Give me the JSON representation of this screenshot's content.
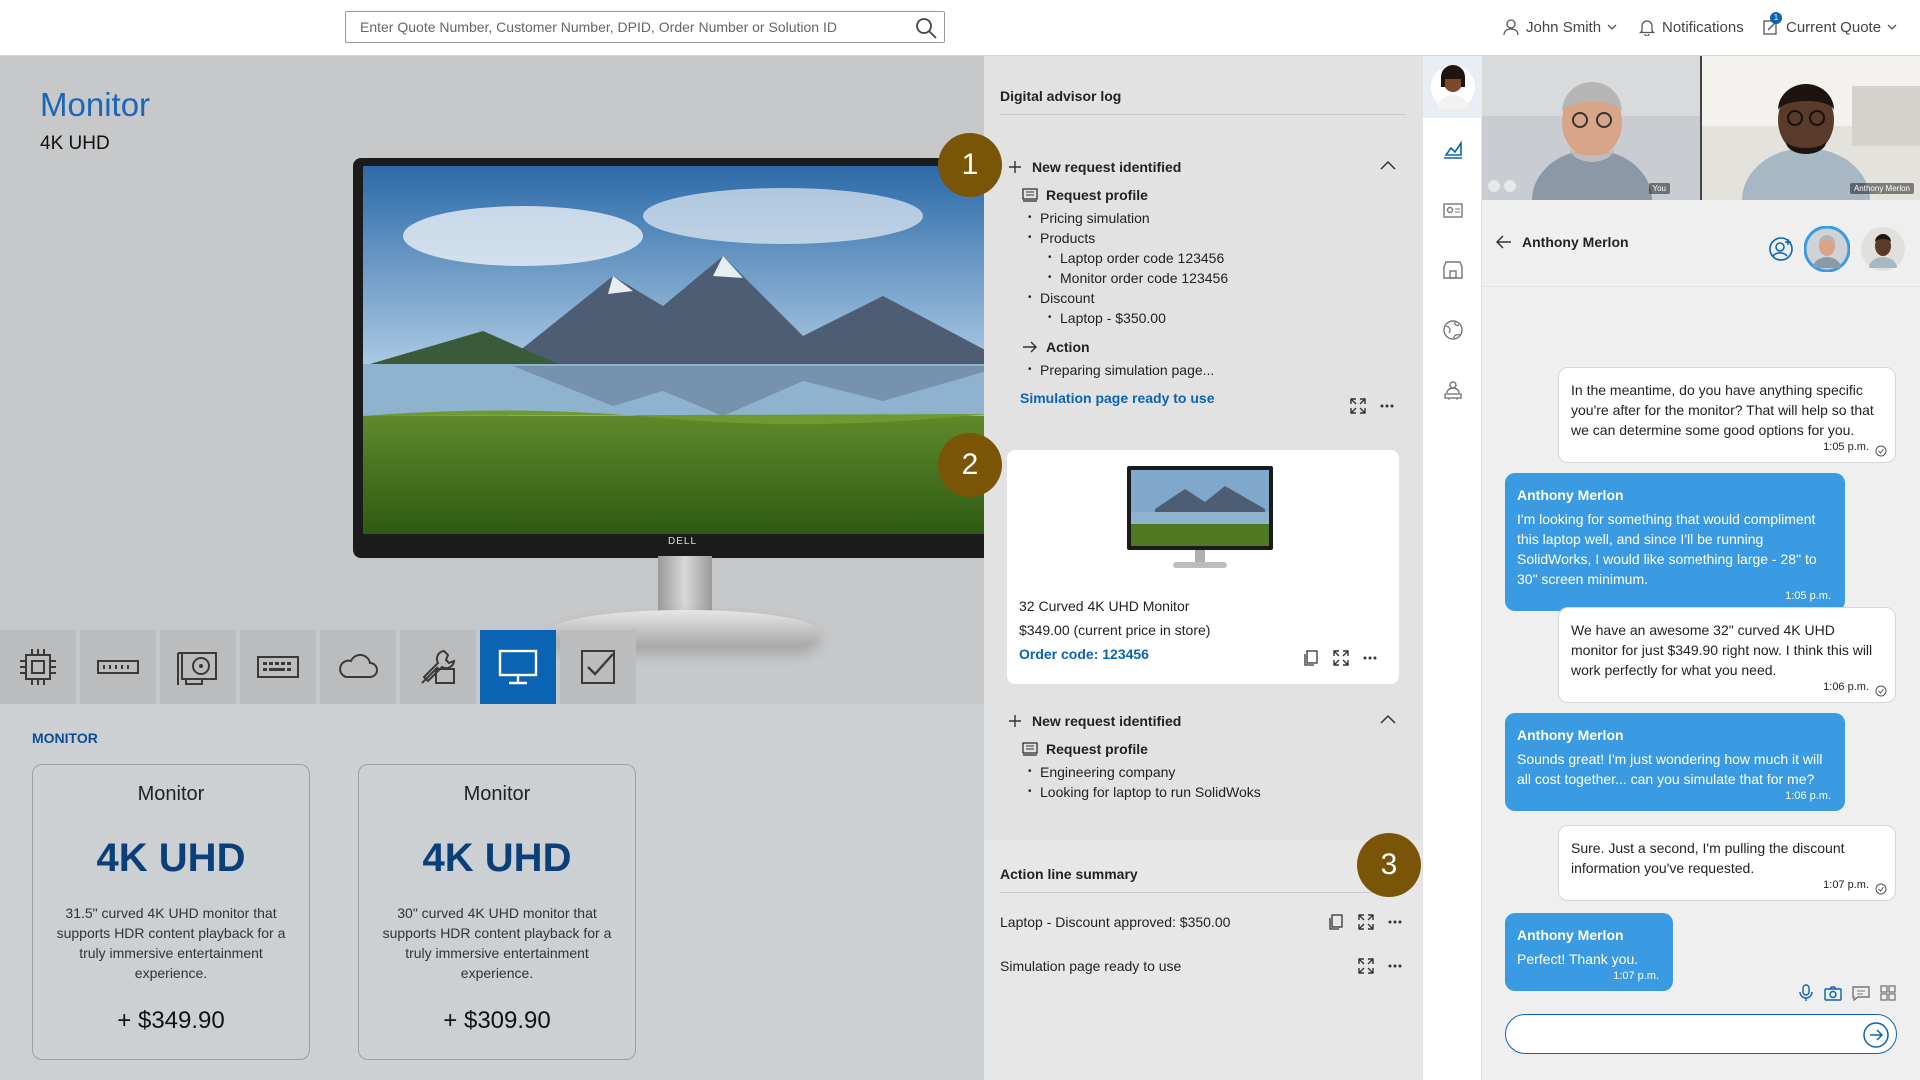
{
  "topbar": {
    "search_placeholder": "Enter Quote Number, Customer Number, DPID, Order Number or Solution ID",
    "user_name": "John Smith",
    "notifications_label": "Notifications",
    "current_quote_label": "Current Quote",
    "quote_badge_count": "1"
  },
  "product": {
    "title": "Monitor",
    "subtitle": "4K UHD",
    "brand_logo": "DELL"
  },
  "categories": [
    {
      "icon": "processor-icon"
    },
    {
      "icon": "memory-icon"
    },
    {
      "icon": "graphics-card-icon"
    },
    {
      "icon": "keyboard-icon"
    },
    {
      "icon": "cloud-icon"
    },
    {
      "icon": "tools-icon"
    },
    {
      "icon": "monitor-icon",
      "active": true
    },
    {
      "icon": "checkbox-icon"
    }
  ],
  "monitor_section": {
    "label": "MONITOR",
    "cards": [
      {
        "name": "Monitor",
        "resolution": "4K UHD",
        "description": "31.5\" curved 4K UHD monitor that supports HDR content playback for a truly immersive entertainment experience.",
        "price": "+ $349.90"
      },
      {
        "name": "Monitor",
        "resolution": "4K UHD",
        "description": "30\" curved 4K UHD monitor that supports HDR content playback for a truly immersive entertainment experience.",
        "price": "+ $309.90"
      }
    ]
  },
  "advisor": {
    "header": "Digital advisor log",
    "badges": [
      "1",
      "2",
      "3"
    ],
    "request1": {
      "title": "New request identified",
      "profile_label": "Request profile",
      "items": {
        "pricing": "Pricing simulation",
        "products": "Products",
        "laptop_code": "Laptop order code 123456",
        "monitor_code": "Monitor order code 123456",
        "discount": "Discount",
        "laptop_discount": "Laptop - $350.00"
      },
      "action_label": "Action",
      "action_item": "Preparing simulation page...",
      "link": "Simulation page ready to use"
    },
    "product_card": {
      "name": "32 Curved 4K UHD Monitor",
      "price": "$349.00 (current price in store)",
      "order_code": "Order code: 123456"
    },
    "request2": {
      "title": "New request identified",
      "profile_label": "Request profile",
      "items": [
        "Engineering company",
        "Looking for laptop to run SolidWoks"
      ]
    },
    "summary": {
      "header": "Action line summary",
      "rows": [
        "Laptop - Discount approved: $350.00",
        "Simulation page ready to use"
      ]
    }
  },
  "video": {
    "you_label": "You",
    "other_label": "Anthony Merlon"
  },
  "chat": {
    "contact_name": "Anthony Merlon",
    "messages": [
      {
        "from": "me",
        "text": "In the meantime, do you have anything specific you're after for the monitor? That will help so that we can determine some good options for you.",
        "time": "1:05 p.m."
      },
      {
        "from": "them",
        "name": "Anthony Merlon",
        "text": "I'm looking for something that would compliment this laptop well, and since I'll be running SolidWorks, I would like something large - 28\" to 30\" screen minimum.",
        "time": "1:05 p.m."
      },
      {
        "from": "me",
        "text": "We have an awesome 32\" curved 4K UHD monitor for just $349.90 right now. I think this will work perfectly for what you need.",
        "time": "1:06 p.m."
      },
      {
        "from": "them",
        "name": "Anthony Merlon",
        "text": "Sounds great! I'm just wondering how much it will all cost together... can you simulate that for me?",
        "time": "1:06 p.m."
      },
      {
        "from": "me",
        "text": "Sure. Just a second, I'm pulling the discount information you've requested.",
        "time": "1:07 p.m."
      },
      {
        "from": "them",
        "name": "Anthony Merlon",
        "text": "Perfect! Thank you.",
        "time": "1:07 p.m."
      }
    ],
    "input_value": ""
  },
  "colors": {
    "accent": "#0b63b3",
    "badge": "#7a5508",
    "bubble_them": "#3a9be2"
  }
}
